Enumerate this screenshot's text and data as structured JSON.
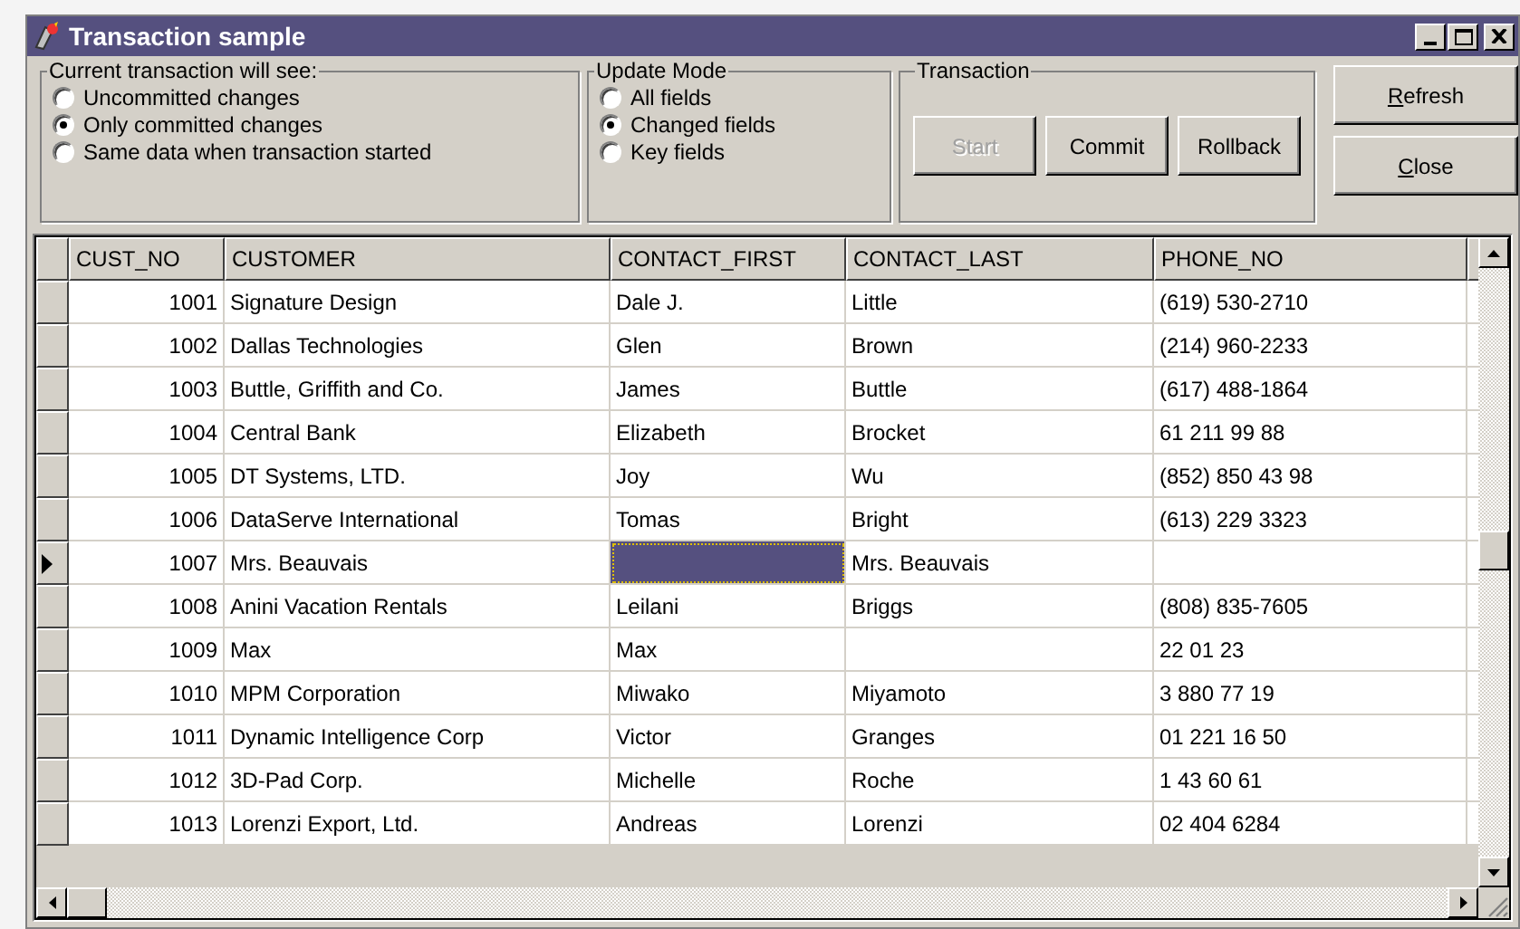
{
  "window": {
    "title": "Transaction sample"
  },
  "groups": [
    {
      "title": "Current transaction will see:",
      "options": [
        {
          "label": "Uncommitted changes",
          "selected": false
        },
        {
          "label": "Only committed changes",
          "selected": true
        },
        {
          "label": "Same data when transaction started",
          "selected": false
        }
      ]
    },
    {
      "title": "Update Mode",
      "options": [
        {
          "label": "All fields",
          "selected": false
        },
        {
          "label": "Changed fields",
          "selected": true
        },
        {
          "label": "Key fields",
          "selected": false
        }
      ]
    }
  ],
  "transaction": {
    "title": "Transaction",
    "buttons": [
      {
        "label": "Start",
        "disabled": true
      },
      {
        "label": "Commit",
        "disabled": false
      },
      {
        "label": "Rollback",
        "disabled": false
      }
    ]
  },
  "side_buttons": [
    {
      "label": "Refresh",
      "underline_first": true
    },
    {
      "label": "Close",
      "underline_first": true
    }
  ],
  "table": {
    "columns": [
      "CUST_NO",
      "CUSTOMER",
      "CONTACT_FIRST",
      "CONTACT_LAST",
      "PHONE_NO"
    ],
    "rows": [
      {
        "cells": [
          "1001",
          "Signature Design",
          "Dale J.",
          "Little",
          "(619) 530-2710"
        ],
        "selected": false
      },
      {
        "cells": [
          "1002",
          "Dallas Technologies",
          "Glen",
          "Brown",
          "(214) 960-2233"
        ],
        "selected": false
      },
      {
        "cells": [
          "1003",
          "Buttle, Griffith and Co.",
          "James",
          "Buttle",
          "(617) 488-1864"
        ],
        "selected": false
      },
      {
        "cells": [
          "1004",
          "Central Bank",
          "Elizabeth",
          "Brocket",
          "61 211 99 88"
        ],
        "selected": false
      },
      {
        "cells": [
          "1005",
          "DT Systems, LTD.",
          "Joy",
          "Wu",
          "(852) 850 43 98"
        ],
        "selected": false
      },
      {
        "cells": [
          "1006",
          "DataServe International",
          "Tomas",
          "Bright",
          "(613) 229 3323"
        ],
        "selected": false
      },
      {
        "cells": [
          "1007",
          "Mrs. Beauvais",
          "",
          "Mrs. Beauvais",
          ""
        ],
        "selected": true,
        "focused_cells": [
          false,
          false,
          true,
          false,
          false
        ]
      },
      {
        "cells": [
          "1008",
          "Anini Vacation Rentals",
          "Leilani",
          "Briggs",
          "(808) 835-7605"
        ],
        "selected": false
      },
      {
        "cells": [
          "1009",
          "Max",
          "Max",
          "",
          "22 01 23"
        ],
        "selected": false
      },
      {
        "cells": [
          "1010",
          "MPM Corporation",
          "Miwako",
          "Miyamoto",
          "3 880 77 19"
        ],
        "selected": false
      },
      {
        "cells": [
          "1011",
          "Dynamic Intelligence Corp",
          "Victor",
          "Granges",
          "01 221 16 50"
        ],
        "selected": false
      },
      {
        "cells": [
          "1012",
          "3D-Pad Corp.",
          "Michelle",
          "Roche",
          "1 43 60 61"
        ],
        "selected": false
      },
      {
        "cells": [
          "1013",
          "Lorenzi Export, Ltd.",
          "Andreas",
          "Lorenzi",
          "02 404 6284"
        ],
        "selected": false
      }
    ]
  }
}
